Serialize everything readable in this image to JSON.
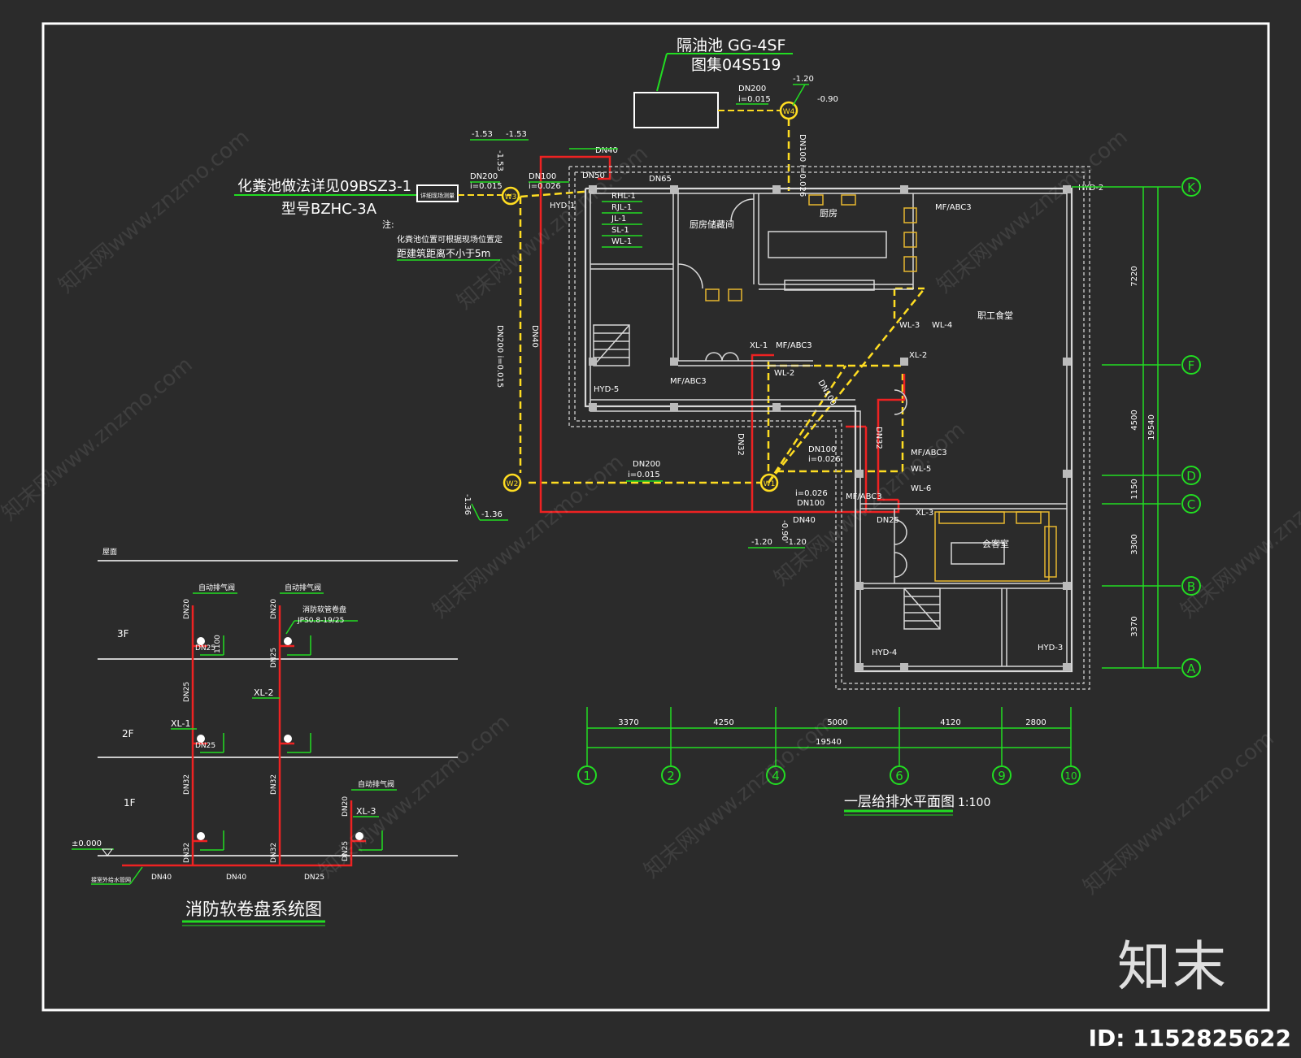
{
  "septic": {
    "title": "化粪池做法详见09BSZ3-1",
    "model": "型号BZHC-3A",
    "note_label": "注:",
    "note_line1": "化粪池位置可根据现场位置定",
    "note_line2": "距建筑距离不小于5m",
    "box_label": "详细现场测量"
  },
  "grease_trap": {
    "title": "隔油池 GG-4SF",
    "atlas": "图集04S519"
  },
  "manholes": [
    "W1",
    "W2",
    "W3",
    "W4"
  ],
  "pipe_labels": {
    "dn200_w4": "DN200",
    "i_w4": "i=0.015",
    "w4_lvl1": "-1.20",
    "w4_lvl2": "-0.90",
    "w4_vert": "DN100 i=0.026",
    "w3_lvl1": "-1.53",
    "w3_lvl2": "-1.53",
    "w3_lvl3": "-1.53",
    "dn200_w3": "DN200",
    "i_w3": "i=0.015",
    "dn100_w3": "DN100",
    "i_w3b": "i=0.026",
    "dn40_top": "DN40",
    "dn50": "DN50",
    "dn65": "DN65",
    "w3w2_vert": "DN200 i=0.015",
    "dn40_vert": "DN40",
    "dn200_w2w1": "DN200",
    "i_w2w1": "i=0.015",
    "w2_lvl": "-1.36",
    "w2_lvl2": "-1.36",
    "dn32_a": "DN32",
    "dn32_b": "DN32",
    "dn100_c": "DN100",
    "i_c": "i=0.026",
    "dn100_d": "DN100",
    "i_d": "i=0.026",
    "dn100_e": "DN100",
    "dn40_w1": "DN40",
    "dn25_w1": "DN25",
    "w1_lvl1": "-1.20",
    "w1_lvl2": "-1.20",
    "w1_lvl3": "-0.90"
  },
  "plan_tags": {
    "hyd1": "HYD-1",
    "hyd2": "HYD-2",
    "hyd3": "HYD-3",
    "hyd4": "HYD-4",
    "hyd5": "HYD-5",
    "wl1": "WL-1",
    "jl1": "JL-1",
    "rhl1": "RHL-1",
    "rjl1": "RJL-1",
    "sl1": "SL-1",
    "mf_k": "MF/ABC3",
    "mf_a": "MF/ABC3",
    "mf_b": "MF/ABC3",
    "mf_c": "MF/ABC3",
    "mf_d": "MF/ABC3",
    "xl1": "XL-1",
    "xl2": "XL-2",
    "xl3": "XL-3",
    "wl2": "WL-2",
    "wl3": "WL-3",
    "wl4": "WL-4",
    "wl5": "WL-5",
    "wl6": "WL-6"
  },
  "rooms": {
    "kitchen_store": "厨房储藏间",
    "kitchen": "厨房",
    "staff_canteen": "职工食堂",
    "meeting": "会客室"
  },
  "axes_right": [
    {
      "id": "K",
      "dim": "7220"
    },
    {
      "id": "F",
      "dim": "4500"
    },
    {
      "id": "D",
      "dim": "1150"
    },
    {
      "id": "C",
      "dim": "3300"
    },
    {
      "id": "B",
      "dim": "3370"
    },
    {
      "id": "A",
      "dim": ""
    }
  ],
  "right_total": "19540",
  "axes_bottom": [
    {
      "id": "1",
      "dim": "3370"
    },
    {
      "id": "2",
      "dim": "4250"
    },
    {
      "id": "4",
      "dim": "5000"
    },
    {
      "id": "6",
      "dim": "4120"
    },
    {
      "id": "9",
      "dim": "2800"
    },
    {
      "id": "10",
      "dim": ""
    }
  ],
  "bottom_total": "19540",
  "plan_title": "一层给排水平面图",
  "plan_scale": "1:100",
  "system": {
    "title": "消防软卷盘系统图",
    "roof": "屋面",
    "floors": [
      "3F",
      "2F",
      "1F"
    ],
    "ground_level": "±0.000",
    "inlet_note": "接室外给水管网",
    "auto_vent_1": "自动排气阀",
    "auto_vent_2": "自动排气阀",
    "auto_vent_3": "自动排气阀",
    "reel_note": "消防软管卷盘",
    "reel_model": "JPS0.8-19/25",
    "xl1": "XL-1",
    "xl2": "XL-2",
    "xl3": "XL-3",
    "dn20_a": "DN20",
    "dn20_b": "DN20",
    "dn20_c": "DN20",
    "dn25_a": "DN25",
    "dn25_b": "DN25",
    "dn25_c": "DN25",
    "dn25_d": "DN25",
    "dn32_a": "DN32",
    "dn32_b": "DN32",
    "dn32_c": "DN32",
    "dn32_d": "DN32",
    "dn40_a": "DN40",
    "dn40_b": "DN40",
    "dn25_main": "DN25",
    "h1100": "1100",
    "dn25_branch": "DN25"
  },
  "watermark": "知末网www.znzmo.com",
  "logo": "知末",
  "image_id": "ID: 1152825622"
}
